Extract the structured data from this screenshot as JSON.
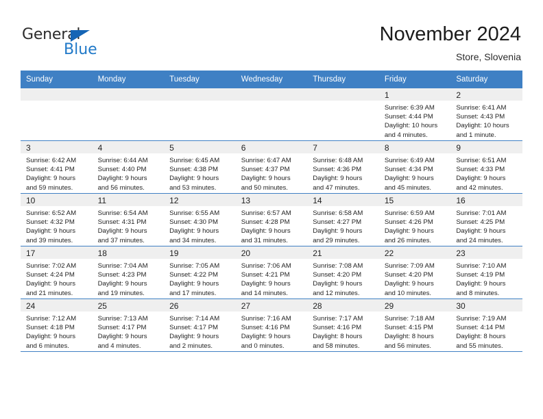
{
  "brand": {
    "name_part1": "General",
    "name_part2": "Blue",
    "accent_color": "#2079c8",
    "triangle_color": "#1565b5"
  },
  "header": {
    "month_title": "November 2024",
    "location": "Store, Slovenia"
  },
  "calendar": {
    "header_bg": "#3f80c4",
    "row_divider": "#3f80c4",
    "daynum_bg": "#efefef",
    "weekday_names": [
      "Sunday",
      "Monday",
      "Tuesday",
      "Wednesday",
      "Thursday",
      "Friday",
      "Saturday"
    ],
    "weeks": [
      [
        {
          "day": "",
          "lines": []
        },
        {
          "day": "",
          "lines": []
        },
        {
          "day": "",
          "lines": []
        },
        {
          "day": "",
          "lines": []
        },
        {
          "day": "",
          "lines": []
        },
        {
          "day": "1",
          "lines": [
            "Sunrise: 6:39 AM",
            "Sunset: 4:44 PM",
            "Daylight: 10 hours",
            "and 4 minutes."
          ]
        },
        {
          "day": "2",
          "lines": [
            "Sunrise: 6:41 AM",
            "Sunset: 4:43 PM",
            "Daylight: 10 hours",
            "and 1 minute."
          ]
        }
      ],
      [
        {
          "day": "3",
          "lines": [
            "Sunrise: 6:42 AM",
            "Sunset: 4:41 PM",
            "Daylight: 9 hours",
            "and 59 minutes."
          ]
        },
        {
          "day": "4",
          "lines": [
            "Sunrise: 6:44 AM",
            "Sunset: 4:40 PM",
            "Daylight: 9 hours",
            "and 56 minutes."
          ]
        },
        {
          "day": "5",
          "lines": [
            "Sunrise: 6:45 AM",
            "Sunset: 4:38 PM",
            "Daylight: 9 hours",
            "and 53 minutes."
          ]
        },
        {
          "day": "6",
          "lines": [
            "Sunrise: 6:47 AM",
            "Sunset: 4:37 PM",
            "Daylight: 9 hours",
            "and 50 minutes."
          ]
        },
        {
          "day": "7",
          "lines": [
            "Sunrise: 6:48 AM",
            "Sunset: 4:36 PM",
            "Daylight: 9 hours",
            "and 47 minutes."
          ]
        },
        {
          "day": "8",
          "lines": [
            "Sunrise: 6:49 AM",
            "Sunset: 4:34 PM",
            "Daylight: 9 hours",
            "and 45 minutes."
          ]
        },
        {
          "day": "9",
          "lines": [
            "Sunrise: 6:51 AM",
            "Sunset: 4:33 PM",
            "Daylight: 9 hours",
            "and 42 minutes."
          ]
        }
      ],
      [
        {
          "day": "10",
          "lines": [
            "Sunrise: 6:52 AM",
            "Sunset: 4:32 PM",
            "Daylight: 9 hours",
            "and 39 minutes."
          ]
        },
        {
          "day": "11",
          "lines": [
            "Sunrise: 6:54 AM",
            "Sunset: 4:31 PM",
            "Daylight: 9 hours",
            "and 37 minutes."
          ]
        },
        {
          "day": "12",
          "lines": [
            "Sunrise: 6:55 AM",
            "Sunset: 4:30 PM",
            "Daylight: 9 hours",
            "and 34 minutes."
          ]
        },
        {
          "day": "13",
          "lines": [
            "Sunrise: 6:57 AM",
            "Sunset: 4:28 PM",
            "Daylight: 9 hours",
            "and 31 minutes."
          ]
        },
        {
          "day": "14",
          "lines": [
            "Sunrise: 6:58 AM",
            "Sunset: 4:27 PM",
            "Daylight: 9 hours",
            "and 29 minutes."
          ]
        },
        {
          "day": "15",
          "lines": [
            "Sunrise: 6:59 AM",
            "Sunset: 4:26 PM",
            "Daylight: 9 hours",
            "and 26 minutes."
          ]
        },
        {
          "day": "16",
          "lines": [
            "Sunrise: 7:01 AM",
            "Sunset: 4:25 PM",
            "Daylight: 9 hours",
            "and 24 minutes."
          ]
        }
      ],
      [
        {
          "day": "17",
          "lines": [
            "Sunrise: 7:02 AM",
            "Sunset: 4:24 PM",
            "Daylight: 9 hours",
            "and 21 minutes."
          ]
        },
        {
          "day": "18",
          "lines": [
            "Sunrise: 7:04 AM",
            "Sunset: 4:23 PM",
            "Daylight: 9 hours",
            "and 19 minutes."
          ]
        },
        {
          "day": "19",
          "lines": [
            "Sunrise: 7:05 AM",
            "Sunset: 4:22 PM",
            "Daylight: 9 hours",
            "and 17 minutes."
          ]
        },
        {
          "day": "20",
          "lines": [
            "Sunrise: 7:06 AM",
            "Sunset: 4:21 PM",
            "Daylight: 9 hours",
            "and 14 minutes."
          ]
        },
        {
          "day": "21",
          "lines": [
            "Sunrise: 7:08 AM",
            "Sunset: 4:20 PM",
            "Daylight: 9 hours",
            "and 12 minutes."
          ]
        },
        {
          "day": "22",
          "lines": [
            "Sunrise: 7:09 AM",
            "Sunset: 4:20 PM",
            "Daylight: 9 hours",
            "and 10 minutes."
          ]
        },
        {
          "day": "23",
          "lines": [
            "Sunrise: 7:10 AM",
            "Sunset: 4:19 PM",
            "Daylight: 9 hours",
            "and 8 minutes."
          ]
        }
      ],
      [
        {
          "day": "24",
          "lines": [
            "Sunrise: 7:12 AM",
            "Sunset: 4:18 PM",
            "Daylight: 9 hours",
            "and 6 minutes."
          ]
        },
        {
          "day": "25",
          "lines": [
            "Sunrise: 7:13 AM",
            "Sunset: 4:17 PM",
            "Daylight: 9 hours",
            "and 4 minutes."
          ]
        },
        {
          "day": "26",
          "lines": [
            "Sunrise: 7:14 AM",
            "Sunset: 4:17 PM",
            "Daylight: 9 hours",
            "and 2 minutes."
          ]
        },
        {
          "day": "27",
          "lines": [
            "Sunrise: 7:16 AM",
            "Sunset: 4:16 PM",
            "Daylight: 9 hours",
            "and 0 minutes."
          ]
        },
        {
          "day": "28",
          "lines": [
            "Sunrise: 7:17 AM",
            "Sunset: 4:16 PM",
            "Daylight: 8 hours",
            "and 58 minutes."
          ]
        },
        {
          "day": "29",
          "lines": [
            "Sunrise: 7:18 AM",
            "Sunset: 4:15 PM",
            "Daylight: 8 hours",
            "and 56 minutes."
          ]
        },
        {
          "day": "30",
          "lines": [
            "Sunrise: 7:19 AM",
            "Sunset: 4:14 PM",
            "Daylight: 8 hours",
            "and 55 minutes."
          ]
        }
      ]
    ]
  }
}
